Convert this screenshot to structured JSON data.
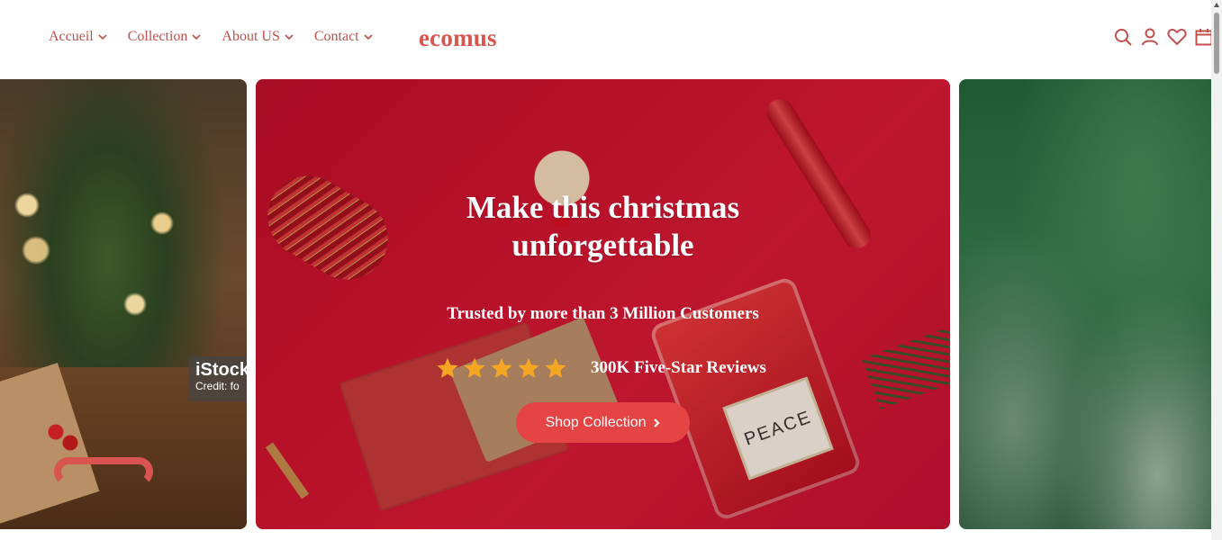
{
  "header": {
    "nav": [
      {
        "label": "Accueil"
      },
      {
        "label": "Collection"
      },
      {
        "label": "About US"
      },
      {
        "label": "Contact"
      }
    ],
    "logo": "ecomus",
    "icons": [
      "search-icon",
      "user-icon",
      "heart-icon",
      "calendar-icon"
    ]
  },
  "slides": {
    "left": {
      "watermark_brand": "iStock",
      "watermark_credit": "Credit: fo"
    },
    "center": {
      "title_line1": "Make this christmas",
      "title_line2": "unforgettable",
      "subtitle": "Trusted by more than 3 Million Customers",
      "rating_stars": 5,
      "reviews_label": "300K Five-Star Reviews",
      "cta_label": "Shop Collection",
      "jar_label": "PEACE"
    }
  },
  "colors": {
    "accent": "#c0504d",
    "logo": "#d9544d",
    "button": "#e54444",
    "star": "#f5a623"
  }
}
